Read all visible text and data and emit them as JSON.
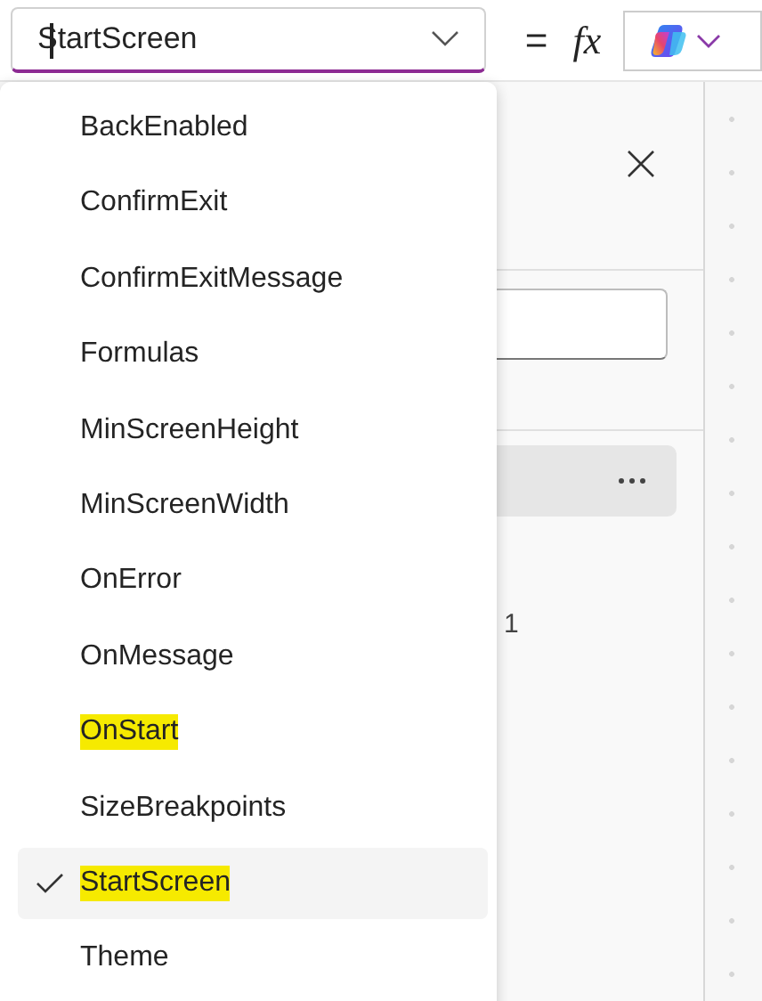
{
  "property_selector": {
    "value": "StartScreen"
  },
  "formula_bar": {
    "equals": "=",
    "fx": "fx"
  },
  "panel": {
    "partial_text": "1"
  },
  "dropdown": {
    "items": [
      {
        "label": "BackEnabled",
        "selected": false,
        "highlighted": false
      },
      {
        "label": "ConfirmExit",
        "selected": false,
        "highlighted": false
      },
      {
        "label": "ConfirmExitMessage",
        "selected": false,
        "highlighted": false
      },
      {
        "label": "Formulas",
        "selected": false,
        "highlighted": false
      },
      {
        "label": "MinScreenHeight",
        "selected": false,
        "highlighted": false
      },
      {
        "label": "MinScreenWidth",
        "selected": false,
        "highlighted": false
      },
      {
        "label": "OnError",
        "selected": false,
        "highlighted": false
      },
      {
        "label": "OnMessage",
        "selected": false,
        "highlighted": false
      },
      {
        "label": "OnStart",
        "selected": false,
        "highlighted": true
      },
      {
        "label": "SizeBreakpoints",
        "selected": false,
        "highlighted": false
      },
      {
        "label": "StartScreen",
        "selected": true,
        "highlighted": true
      },
      {
        "label": "Theme",
        "selected": false,
        "highlighted": false
      }
    ]
  }
}
